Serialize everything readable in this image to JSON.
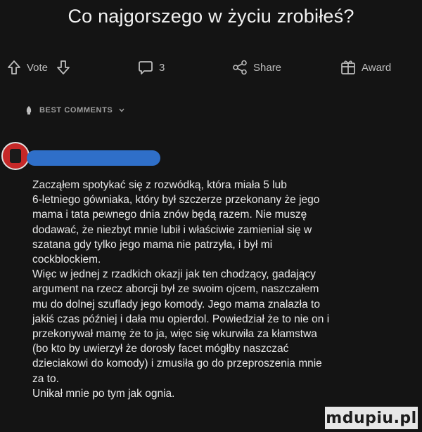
{
  "post": {
    "title": "Co najgorszego w życiu zrobiłeś?"
  },
  "actions": {
    "vote_label": "Vote",
    "comment_count": "3",
    "share_label": "Share",
    "award_label": "Award"
  },
  "comments_header": {
    "label": "BEST COMMENTS"
  },
  "comment": {
    "p1": "Zacząłem spotykać się z rozwódką, która miała 5 lub\n6-letniego gówniaka, który był szczerze przekonany że jego\nmama i tata pewnego dnia znów będą razem. Nie muszę\ndodawać, że niezbyt mnie lubił i właściwie zamieniał się w\nszatana gdy tylko jego mama nie patrzyła, i był mi\ncockblockiem.",
    "p2": "Więc w jednej z rzadkich okazji jak ten chodzący, gadający\nargument na rzecz aborcji był ze swoim ojcem, naszczałem\nmu do dolnej szuflady jego komody. Jego mama znalazła to\njakiś czas później i dała mu opierdol. Powiedział że to nie on i\nprzekonywał mamę że to ja, więc się wkurwiła za kłamstwa\n(bo kto by uwierzył że dorosły facet mógłby naszczać\ndzieciakowi do komody) i zmusiła go do przeproszenia mnie\nza to.",
    "p3": "Unikał mnie po tym jak ognia."
  },
  "watermark": {
    "text": "mdupiu.pl"
  }
}
